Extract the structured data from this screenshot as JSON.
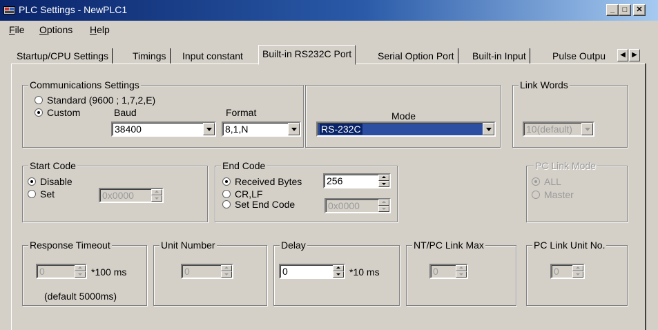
{
  "window": {
    "title": "PLC Settings - NewPLC1",
    "min_icon": "_",
    "max_icon": "□",
    "close_icon": "✕"
  },
  "menu": [
    {
      "hotkey": "F",
      "rest": "ile"
    },
    {
      "hotkey": "O",
      "rest": "ptions"
    },
    {
      "hotkey": "H",
      "rest": "elp"
    }
  ],
  "tabs": [
    {
      "label": "Startup/CPU Settings",
      "active": false
    },
    {
      "label": "Timings",
      "active": false
    },
    {
      "label": "Input constant",
      "active": false
    },
    {
      "label": "Built-in RS232C Port",
      "active": true
    },
    {
      "label": "Serial Option Port",
      "active": false
    },
    {
      "label": "Built-in Input",
      "active": false
    },
    {
      "label": "Pulse Outpu",
      "active": false
    }
  ],
  "tab_scroll": {
    "left": "◀",
    "right": "▶"
  },
  "comm": {
    "title": "Communications Settings",
    "standard_label": "Standard (9600 ; 1,7,2,E)",
    "custom_label": "Custom",
    "selected": "custom",
    "baud_label": "Baud",
    "baud_value": "38400",
    "format_label": "Format",
    "format_value": "8,1,N",
    "mode_label": "Mode",
    "mode_value": "RS-232C"
  },
  "link_words": {
    "title": "Link Words",
    "value": "10(default)"
  },
  "start_code": {
    "title": "Start Code",
    "disable_label": "Disable",
    "set_label": "Set",
    "selected": "disable",
    "value": "0x0000"
  },
  "end_code": {
    "title": "End Code",
    "received_label": "Received Bytes",
    "received_value": "256",
    "crlf_label": "CR,LF",
    "set_label": "Set End Code",
    "set_value": "0x0000",
    "selected": "received"
  },
  "pc_link_mode": {
    "title": "PC Link Mode",
    "all_label": "ALL",
    "master_label": "Master",
    "selected": "all"
  },
  "response_timeout": {
    "title": "Response Timeout",
    "value": "0",
    "unit": "*100 ms",
    "note": "(default 5000ms)"
  },
  "unit_number": {
    "title": "Unit Number",
    "value": "0"
  },
  "delay": {
    "title": "Delay",
    "value": "0",
    "unit": "*10 ms"
  },
  "nt_pc_link_max": {
    "title": "NT/PC Link Max",
    "value": "0"
  },
  "pc_link_unit_no": {
    "title": "PC Link Unit No.",
    "value": "0"
  }
}
